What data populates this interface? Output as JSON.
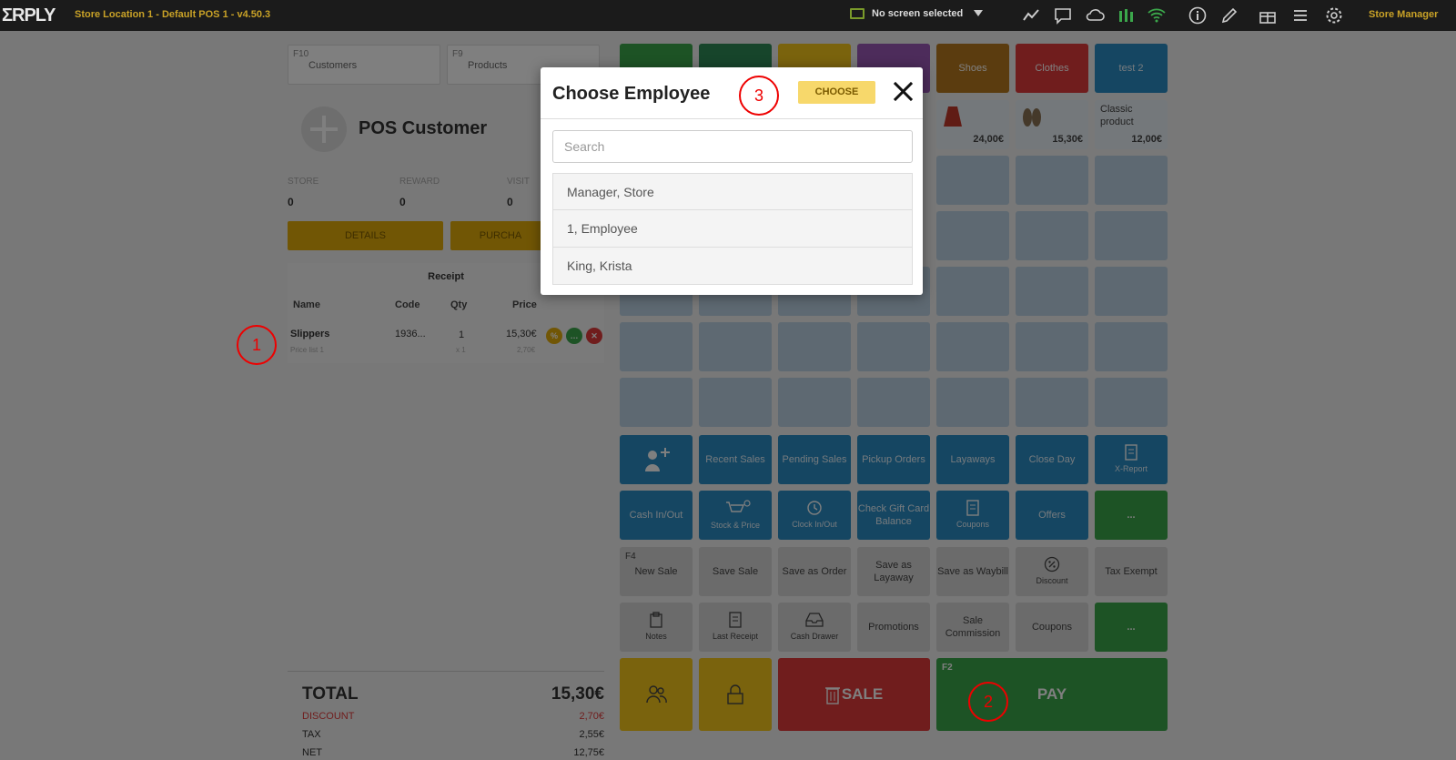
{
  "topbar": {
    "logo": "ΣRPLY",
    "store_title": "Store Location 1 - Default POS 1 - v4.50.3",
    "screen_select": "No screen selected",
    "user_menu": "Store Manager"
  },
  "search": {
    "customers": {
      "key": "F10",
      "label": "Customers"
    },
    "products": {
      "key": "F9",
      "label": "Products"
    }
  },
  "customer": {
    "name": "POS Customer",
    "stats": [
      {
        "label": "STORE",
        "value": "0"
      },
      {
        "label": "REWARD",
        "value": "0"
      },
      {
        "label": "VISIT",
        "value": "0"
      }
    ],
    "details_label": "DETAILS",
    "purchases_label": "PURCHA"
  },
  "receipt": {
    "title": "Receipt",
    "headers": {
      "name": "Name",
      "code": "Code",
      "qty": "Qty",
      "price": "Price"
    },
    "rows": [
      {
        "name": "Slippers",
        "sub": "Price list 1",
        "code": "1936...",
        "qty": "1",
        "qty_sub": "x 1",
        "price": "15,30€",
        "price_sub": "2,70€"
      }
    ]
  },
  "totals": {
    "total_label": "TOTAL",
    "total_value": "15,30€",
    "discount_label": "DISCOUNT",
    "discount_value": "2,70€",
    "tax_label": "TAX",
    "tax_value": "2,55€",
    "net_label": "NET",
    "net_value": "12,75€"
  },
  "grid": {
    "row1": [
      "",
      "",
      "",
      "",
      "Shoes",
      "Clothes",
      "test 2"
    ],
    "products": [
      {
        "price": "24,00€"
      },
      {
        "price": "15,30€"
      },
      {
        "name": "Classic product",
        "price": "12,00€"
      }
    ],
    "functions_row1": [
      "",
      "Recent Sales",
      "Pending Sales",
      "Pickup Orders",
      "Layaways",
      "Close Day",
      "X-Report"
    ],
    "functions_row2": [
      "Cash In/Out",
      "Stock & Price",
      "Clock In/Out",
      "Check Gift Card Balance",
      "Coupons",
      "Offers",
      "..."
    ],
    "functions_row3": [
      {
        "key": "F4",
        "label": "New Sale"
      },
      {
        "label": "Save Sale"
      },
      {
        "label": "Save as Order"
      },
      {
        "label": "Save as Layaway"
      },
      {
        "label": "Save as Waybill"
      },
      {
        "label": "Discount"
      },
      {
        "label": "Tax Exempt"
      }
    ],
    "functions_row4": [
      "Notes",
      "Last Receipt",
      "Cash Drawer",
      "Promotions",
      "Sale Commission",
      "Coupons",
      "..."
    ],
    "sale_label": "SALE",
    "pay_key": "F2",
    "pay_label": "PAY"
  },
  "annotations": [
    "1",
    "2",
    "3"
  ],
  "modal": {
    "title": "Choose Employee",
    "choose_label": "CHOOSE",
    "search_placeholder": "Search",
    "search_value": "",
    "employees": [
      "Manager, Store",
      "1, Employee",
      "King, Krista"
    ]
  },
  "colors": {
    "accent_yellow": "#e3ad0b",
    "pay_green": "#3ba74b",
    "sale_red": "#e03b3b",
    "function_blue": "#2a8dc5",
    "discount_red": "#e03b3b"
  }
}
